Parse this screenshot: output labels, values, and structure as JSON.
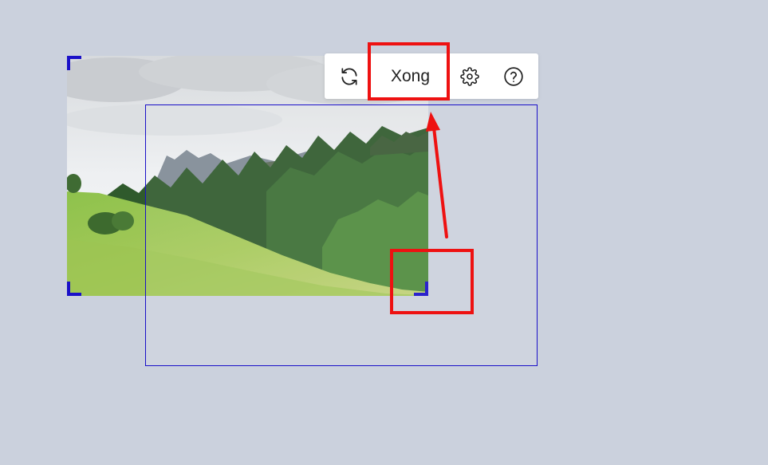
{
  "toolbar": {
    "done_label": "Xong",
    "icons": {
      "reset": "refresh-icon",
      "settings": "gear-icon",
      "help": "help-circle-icon"
    }
  },
  "colors": {
    "background": "#cbd1dd",
    "crop_frame": "#1a10c8",
    "annotation": "#ee1111"
  }
}
